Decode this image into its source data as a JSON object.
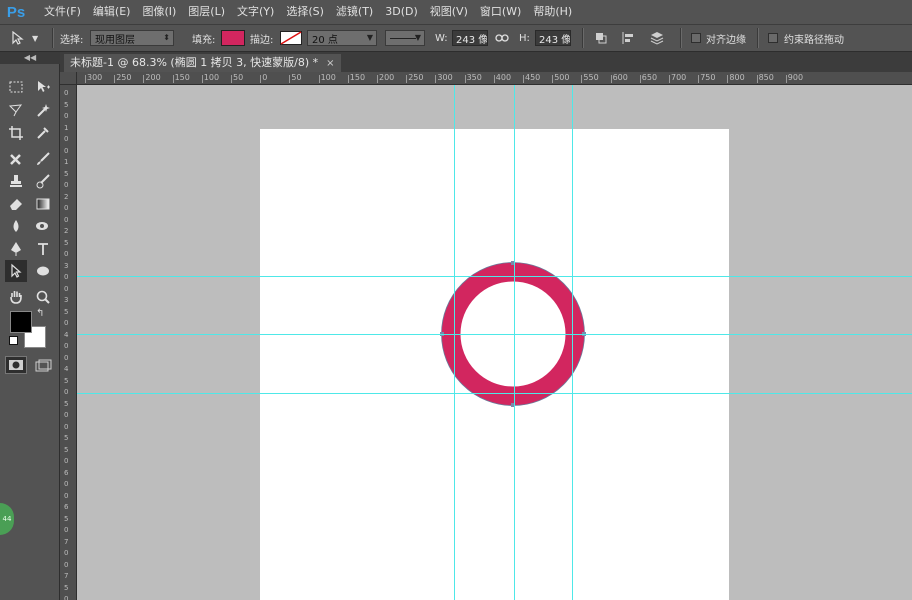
{
  "app": {
    "logo": "Ps"
  },
  "menu": [
    "文件(F)",
    "编辑(E)",
    "图像(I)",
    "图层(L)",
    "文字(Y)",
    "选择(S)",
    "滤镜(T)",
    "3D(D)",
    "视图(V)",
    "窗口(W)",
    "帮助(H)"
  ],
  "options": {
    "select_label": "选择:",
    "select_value": "现用图层",
    "fill_label": "填充:",
    "fill_color": "#d2265f",
    "stroke_label": "描边:",
    "stroke_size": "20 点",
    "width_label": "W:",
    "width_value": "243 像素",
    "height_label": "H:",
    "height_value": "243 像素",
    "align_edges_label": "对齐边缘",
    "constrain_path_label": "约束路径拖动"
  },
  "document_tab": {
    "title": "未标题-1 @ 68.3% (椭圆 1 拷贝 3, 快速蒙版/8) *",
    "close": "×"
  },
  "ruler_top": [
    "300",
    "250",
    "200",
    "150",
    "100",
    "50",
    "0",
    "50",
    "100",
    "150",
    "200",
    "250",
    "300",
    "350",
    "400",
    "450",
    "500",
    "550",
    "600",
    "650",
    "700",
    "750",
    "800",
    "850",
    "900"
  ],
  "ruler_left": [
    "0",
    "5",
    "0",
    "1",
    "0",
    "0",
    "1",
    "5",
    "0",
    "2",
    "0",
    "0",
    "2",
    "5",
    "0",
    "3",
    "0",
    "0",
    "3",
    "5",
    "0",
    "4",
    "0",
    "0",
    "4",
    "5",
    "0",
    "5",
    "0",
    "0",
    "5",
    "5",
    "0",
    "6",
    "0",
    "0",
    "6",
    "5",
    "0",
    "7",
    "0",
    "0",
    "7",
    "5",
    "0"
  ],
  "shape": {
    "fill_color": "#d2265f"
  },
  "colors": {
    "foreground": "#000000",
    "background": "#ffffff",
    "guide": "#4ee8e8",
    "canvas_bg": "#bdbdbd"
  },
  "badge": {
    "text": "44"
  },
  "collapse_label": "◀◀"
}
